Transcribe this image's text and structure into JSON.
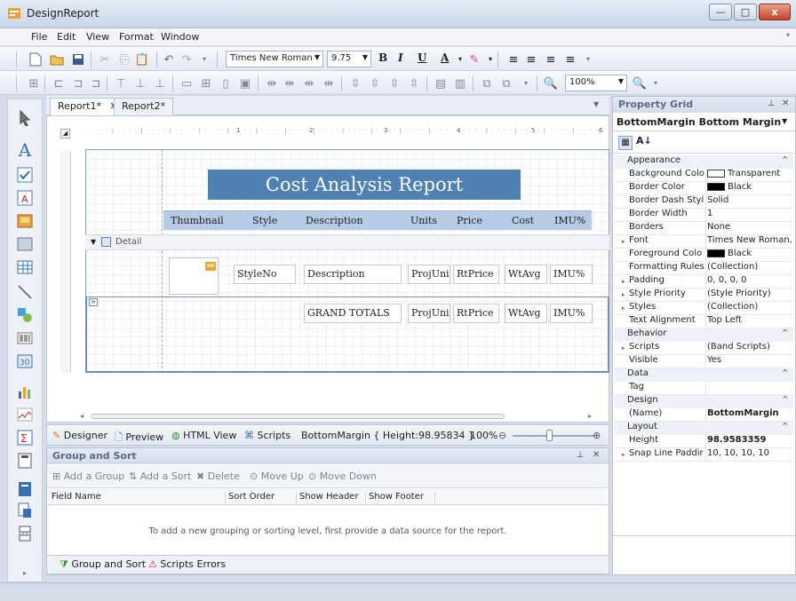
{
  "window": {
    "title": "DesignReport"
  },
  "menu": [
    "File",
    "Edit",
    "View",
    "Format",
    "Window"
  ],
  "toolbar": {
    "font_name": "Times New Roman",
    "font_size": "9.75",
    "bold": "B",
    "italic": "I",
    "underline": "U",
    "font_color": "A",
    "zoom": "100%"
  },
  "tabs": [
    "Report1*",
    "Report2*"
  ],
  "ruler_marks": [
    "1",
    "2",
    "3",
    "4",
    "5",
    "6"
  ],
  "report": {
    "title": "Cost Analysis Report",
    "headers": [
      "Thumbnail",
      "Style",
      "Description",
      "Units",
      "Price",
      "Cost",
      "IMU%"
    ],
    "detail_band": "Detail",
    "detail_fields": [
      "StyleNo",
      "Description",
      "ProjUnit",
      "RtPrice",
      "WtAvg",
      "IMU%"
    ],
    "total_fields": [
      "GRAND TOTALS",
      "ProjUnit",
      "RtPrice",
      "WtAvg",
      "IMU%"
    ]
  },
  "statusbar": {
    "designer": "Designer",
    "preview": "Preview",
    "html_view": "HTML View",
    "scripts": "Scripts",
    "info": "BottomMargin { Height:98.95834 }",
    "zoom": "100%"
  },
  "group_sort": {
    "title": "Group and Sort",
    "buttons": [
      "Add a Group",
      "Add a Sort",
      "Delete",
      "Move Up",
      "Move Down"
    ],
    "columns": [
      "Field Name",
      "Sort Order",
      "Show Header",
      "Show Footer"
    ],
    "hint": "To add a new grouping or sorting level, first provide a data source for the report."
  },
  "bottom_tabs": [
    "Group and Sort",
    "Scripts Errors"
  ],
  "property_grid": {
    "title": "Property Grid",
    "object": "BottomMargin  Bottom Margin",
    "rows": [
      {
        "type": "cat",
        "label": "Appearance"
      },
      {
        "type": "prop",
        "key": "Background Colo",
        "value": "Transparent",
        "swatch": "#ffffff"
      },
      {
        "type": "prop",
        "key": "Border Color",
        "value": "Black",
        "swatch": "#000000"
      },
      {
        "type": "prop",
        "key": "Border Dash Styl",
        "value": "Solid"
      },
      {
        "type": "prop",
        "key": "Border Width",
        "value": "1"
      },
      {
        "type": "prop",
        "key": "Borders",
        "value": "None"
      },
      {
        "type": "prop",
        "key": "Font",
        "value": "Times New Roman, ...",
        "expand": true
      },
      {
        "type": "prop",
        "key": "Foreground Colo",
        "value": "Black",
        "swatch": "#000000"
      },
      {
        "type": "prop",
        "key": "Formatting Rules",
        "value": "(Collection)"
      },
      {
        "type": "prop",
        "key": "Padding",
        "value": "0, 0, 0, 0",
        "expand": true
      },
      {
        "type": "prop",
        "key": "Style Priority",
        "value": "(Style Priority)",
        "expand": true
      },
      {
        "type": "prop",
        "key": "Styles",
        "value": "(Collection)",
        "expand": true
      },
      {
        "type": "prop",
        "key": "Text Alignment",
        "value": "Top Left"
      },
      {
        "type": "cat",
        "label": "Behavior"
      },
      {
        "type": "prop",
        "key": "Scripts",
        "value": "(Band Scripts)",
        "expand": true
      },
      {
        "type": "prop",
        "key": "Visible",
        "value": "Yes"
      },
      {
        "type": "cat",
        "label": "Data"
      },
      {
        "type": "prop",
        "key": "Tag",
        "value": ""
      },
      {
        "type": "cat",
        "label": "Design"
      },
      {
        "type": "prop",
        "key": "(Name)",
        "value": "BottomMargin",
        "bold": true
      },
      {
        "type": "cat",
        "label": "Layout"
      },
      {
        "type": "prop",
        "key": "Height",
        "value": "98.9583359",
        "bold": true
      },
      {
        "type": "prop",
        "key": "Snap Line Paddir",
        "value": "10, 10, 10, 10",
        "expand": true
      }
    ]
  },
  "colors": {
    "accent": "#4f81b3",
    "header_band": "#b8cbe4"
  }
}
